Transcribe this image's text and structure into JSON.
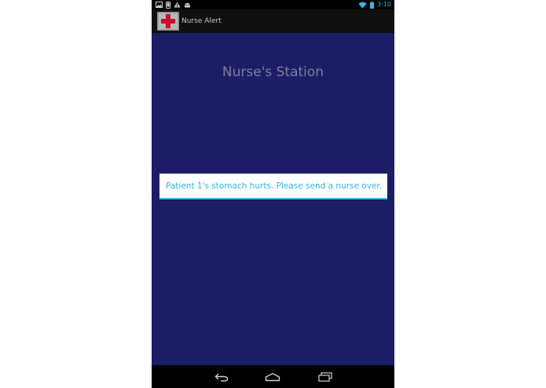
{
  "status_bar": {
    "time": "3:10",
    "left_icons": [
      "gallery-icon",
      "phone-icon",
      "warning-icon",
      "android-icon"
    ],
    "right_icons": [
      "wifi-icon",
      "battery-icon"
    ],
    "accent": "#33b5e5"
  },
  "action_bar": {
    "title": "Nurse Alert",
    "app_icon": "red-cross-icon"
  },
  "main": {
    "title": "Nurse's Station",
    "background": "#1b1d66"
  },
  "alert": {
    "message": "Patient 1's stomach hurts. Please send a nurse over.",
    "color": "#33b5e5"
  },
  "nav_bar": {
    "buttons": [
      "back-icon",
      "home-icon",
      "recent-apps-icon"
    ]
  }
}
